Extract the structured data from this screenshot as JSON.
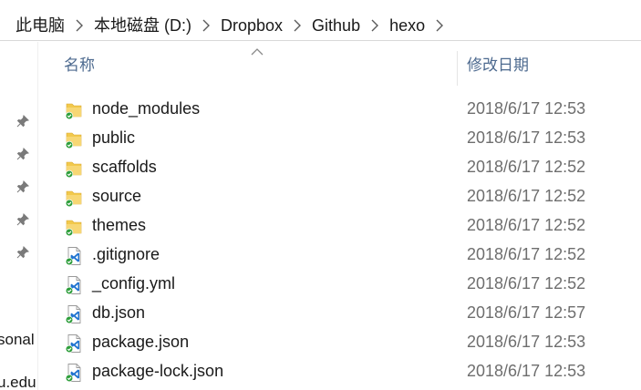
{
  "breadcrumb": {
    "items": [
      "此电脑",
      "本地磁盘 (D:)",
      "Dropbox",
      "Github",
      "hexo"
    ]
  },
  "nav_pane": {
    "pinned_count": 5,
    "partial_items": [
      "sonal",
      "u.edu"
    ]
  },
  "columns": {
    "name": "名称",
    "date_modified": "修改日期"
  },
  "files": [
    {
      "name": "node_modules",
      "date": "2018/6/17 12:53",
      "type": "folder"
    },
    {
      "name": "public",
      "date": "2018/6/17 12:53",
      "type": "folder"
    },
    {
      "name": "scaffolds",
      "date": "2018/6/17 12:52",
      "type": "folder"
    },
    {
      "name": "source",
      "date": "2018/6/17 12:52",
      "type": "folder"
    },
    {
      "name": "themes",
      "date": "2018/6/17 12:52",
      "type": "folder"
    },
    {
      "name": ".gitignore",
      "date": "2018/6/17 12:52",
      "type": "vscode-file"
    },
    {
      "name": "_config.yml",
      "date": "2018/6/17 12:52",
      "type": "vscode-file"
    },
    {
      "name": "db.json",
      "date": "2018/6/17 12:57",
      "type": "vscode-file"
    },
    {
      "name": "package.json",
      "date": "2018/6/17 12:53",
      "type": "vscode-file"
    },
    {
      "name": "package-lock.json",
      "date": "2018/6/17 12:53",
      "type": "vscode-file"
    }
  ],
  "colors": {
    "folder": "#f2c94c",
    "sync_check": "#2e9e3b",
    "vscode_blue": "#1f73d0",
    "header_text": "#4d6a8f",
    "date_text": "#6e6e6e"
  }
}
